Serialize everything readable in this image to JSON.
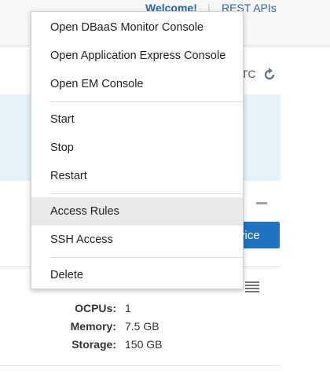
{
  "header": {
    "welcome": "Welcome!",
    "separator": "|",
    "rest_apis": "REST APIs"
  },
  "background": {
    "timezone_fragment": "TC",
    "button_fragment": "vice"
  },
  "menu": {
    "items": [
      {
        "label": "Open DBaaS Monitor Console"
      },
      {
        "label": "Open Application Express Console"
      },
      {
        "label": "Open EM Console"
      },
      {
        "label": "Start"
      },
      {
        "label": "Stop"
      },
      {
        "label": "Restart"
      },
      {
        "label": "Access Rules"
      },
      {
        "label": "SSH Access"
      },
      {
        "label": "Delete"
      }
    ]
  },
  "specs": {
    "ocpus_label": "OCPUs:",
    "ocpus_value": "1",
    "memory_label": "Memory:",
    "memory_value": "7.5 GB",
    "storage_label": "Storage:",
    "storage_value": "150 GB"
  },
  "colors": {
    "link": "#2a65ad",
    "primary_button": "#1f73c2",
    "info_panel": "#e5f3f9",
    "menu_hover": "#eaeaea"
  }
}
